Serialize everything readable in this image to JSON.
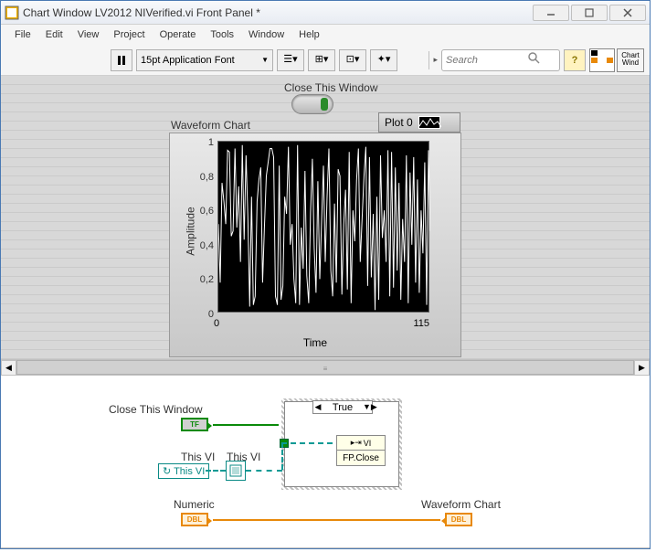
{
  "window": {
    "title": "Chart Window LV2012 NIVerified.vi Front Panel *"
  },
  "menu": {
    "items": [
      "File",
      "Edit",
      "View",
      "Project",
      "Operate",
      "Tools",
      "Window",
      "Help"
    ]
  },
  "toolbar": {
    "font_selector": "15pt Application Font",
    "search_placeholder": "Search",
    "chart_wind_tip": "Chart Wind"
  },
  "front_panel": {
    "close_label": "Close This Window",
    "chart_label": "Waveform Chart",
    "legend_name": "Plot 0",
    "y_title": "Amplitude",
    "x_title": "Time",
    "y_ticks": [
      "1",
      "0,8",
      "0,6",
      "0,4",
      "0,2",
      "0"
    ],
    "x_ticks": [
      "0",
      "115"
    ]
  },
  "block_diagram": {
    "close_label": "Close This Window",
    "tf_text": "TF",
    "thisvi_label": "This VI",
    "thisvi_ref_label": "This VI",
    "thisvi_btn": "↻ This VI",
    "numeric_label": "Numeric",
    "dbl_text": "DBL",
    "wf_label": "Waveform Chart",
    "case_sel": "True",
    "invoke_hdr": "VI",
    "invoke_method": "FP.Close"
  },
  "chart_data": {
    "type": "line",
    "title": "Waveform Chart",
    "xlabel": "Time",
    "ylabel": "Amplitude",
    "xlim": [
      0,
      115
    ],
    "ylim": [
      0,
      1
    ],
    "series": [
      {
        "name": "Plot 0",
        "values": [
          0.52,
          0.18,
          0.76,
          0.65,
          0.52,
          0.95,
          0.94,
          0.45,
          0.48,
          0.96,
          0.5,
          0.74,
          0.3,
          0.98,
          0.43,
          0.92,
          0.56,
          0.04,
          0.68,
          0.05,
          0.1,
          0.65,
          0.78,
          0.85,
          0.18,
          0.5,
          0.8,
          0.88,
          0.96,
          0.96,
          0.91,
          0.1,
          0.05,
          0.86,
          0.08,
          0.16,
          0.68,
          0.58,
          0.97,
          0.4,
          0.52,
          0.2,
          0.06,
          0.98,
          0.05,
          0.5,
          0.26,
          0.83,
          0.22,
          0.06,
          0.59,
          0.9,
          0.38,
          0.12,
          0.77,
          0.2,
          0.54,
          0.86,
          0.3,
          0.68,
          0.96,
          0.25,
          0.1,
          0.64,
          0.18,
          0.84,
          0.8,
          0.11,
          0.52,
          0.72,
          0.14,
          0.94,
          0.06,
          0.6,
          0.42,
          0.78,
          0.96,
          0.3,
          0.56,
          0.8,
          0.97,
          0.16,
          0.91,
          0.21,
          0.58,
          0.02,
          0.68,
          0.08,
          0.92,
          0.44,
          0.6,
          0.3,
          0.95,
          0.1,
          0.94,
          0.15,
          0.85,
          0.25,
          0.76,
          0.08,
          0.55,
          0.3,
          0.92,
          0.06,
          0.82,
          0.4,
          0.91,
          0.18,
          0.78,
          0.12,
          0.6,
          0.35,
          0.88,
          0.05,
          0.95,
          0.48
        ]
      }
    ]
  }
}
